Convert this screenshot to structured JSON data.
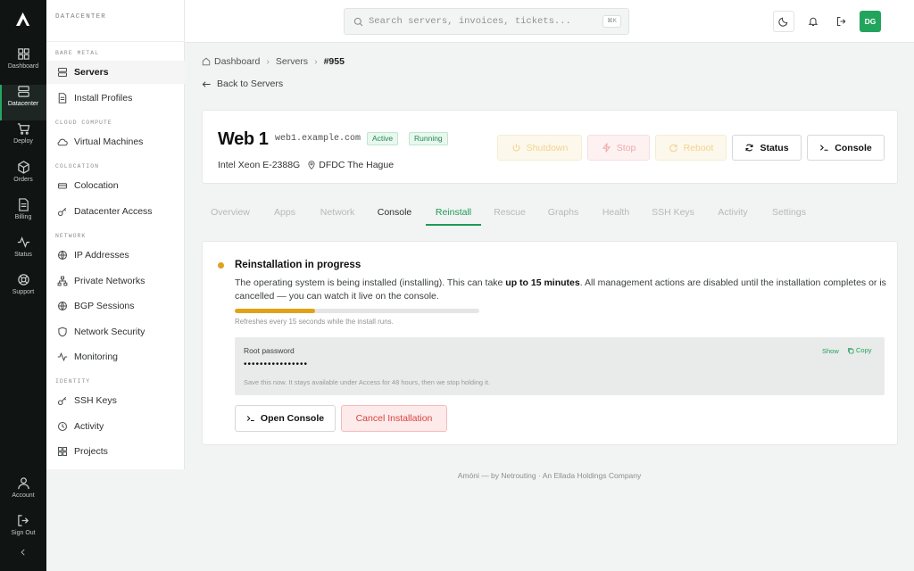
{
  "rail": {
    "items": [
      {
        "label": "Dashboard",
        "icon": "grid-icon"
      },
      {
        "label": "Datacenter",
        "icon": "server-icon",
        "active": true
      },
      {
        "label": "Deploy",
        "icon": "cart-icon"
      },
      {
        "label": "Orders",
        "icon": "box-icon"
      },
      {
        "label": "Billing",
        "icon": "document-icon"
      },
      {
        "label": "Status",
        "icon": "pulse-icon"
      },
      {
        "label": "Support",
        "icon": "lifebuoy-icon"
      }
    ],
    "bottom": [
      {
        "label": "Account",
        "icon": "user-icon"
      },
      {
        "label": "Sign Out",
        "icon": "sign-out-icon"
      }
    ]
  },
  "sidebar": {
    "title": "DATACENTER",
    "sections": [
      {
        "title": "BARE METAL",
        "items": [
          "Servers",
          "Install Profiles"
        ]
      },
      {
        "title": "CLOUD COMPUTE",
        "items": [
          "Virtual Machines"
        ]
      },
      {
        "title": "COLOCATION",
        "items": [
          "Colocation",
          "Datacenter Access"
        ]
      },
      {
        "title": "NETWORK",
        "items": [
          "IP Addresses",
          "Private Networks",
          "BGP Sessions",
          "Network Security",
          "Monitoring"
        ]
      },
      {
        "title": "IDENTITY",
        "items": [
          "SSH Keys",
          "Activity",
          "Projects"
        ]
      }
    ]
  },
  "topbar": {
    "search_placeholder": "Search servers, invoices, tickets...",
    "shortcut": "⌘K",
    "avatar_initials": "DG"
  },
  "breadcrumb": {
    "items": [
      "Dashboard",
      "Servers",
      "#955"
    ]
  },
  "back_label": "Back to Servers",
  "server": {
    "name": "Web 1",
    "hostname": "web1.example.com",
    "badges": [
      "Active",
      "Running"
    ],
    "cpu": "Intel Xeon E-2388G",
    "location": "DFDC The Hague",
    "actions": {
      "shutdown": "Shutdown",
      "stop": "Stop",
      "reboot": "Reboot",
      "status": "Status",
      "console": "Console"
    }
  },
  "tabs": [
    {
      "label": "Overview",
      "enabled": false
    },
    {
      "label": "Apps",
      "enabled": false
    },
    {
      "label": "Network",
      "enabled": false
    },
    {
      "label": "Console",
      "enabled": true
    },
    {
      "label": "Reinstall",
      "enabled": true,
      "active": true
    },
    {
      "label": "Rescue",
      "enabled": false
    },
    {
      "label": "Graphs",
      "enabled": false
    },
    {
      "label": "Health",
      "enabled": false
    },
    {
      "label": "SSH Keys",
      "enabled": false
    },
    {
      "label": "Activity",
      "enabled": false
    },
    {
      "label": "Settings",
      "enabled": false
    }
  ],
  "reinstall": {
    "title": "Reinstallation in progress",
    "desc_before": "The operating system is being installed (installing). This can take ",
    "desc_bold": "up to 15 minutes",
    "desc_after": ". All management actions are disabled until the installation completes or is cancelled — you can watch it live on the console.",
    "progress_percent": 33,
    "refresh_note": "Refreshes every 15 seconds while the install runs.",
    "password_label": "Root password",
    "password_masked": "••••••••••••••••",
    "show_label": "Show",
    "copy_label": "Copy",
    "password_note": "Save this now. It stays available under Access for 48 hours, then we stop holding it.",
    "open_console": "Open Console",
    "cancel": "Cancel Installation"
  },
  "footer": "Amóni — by Netrouting · An Ellada Holdings Company",
  "colors": {
    "accent": "#1f9a57",
    "warning": "#e3a216",
    "danger": "#d9443f",
    "rail": "#101413"
  }
}
